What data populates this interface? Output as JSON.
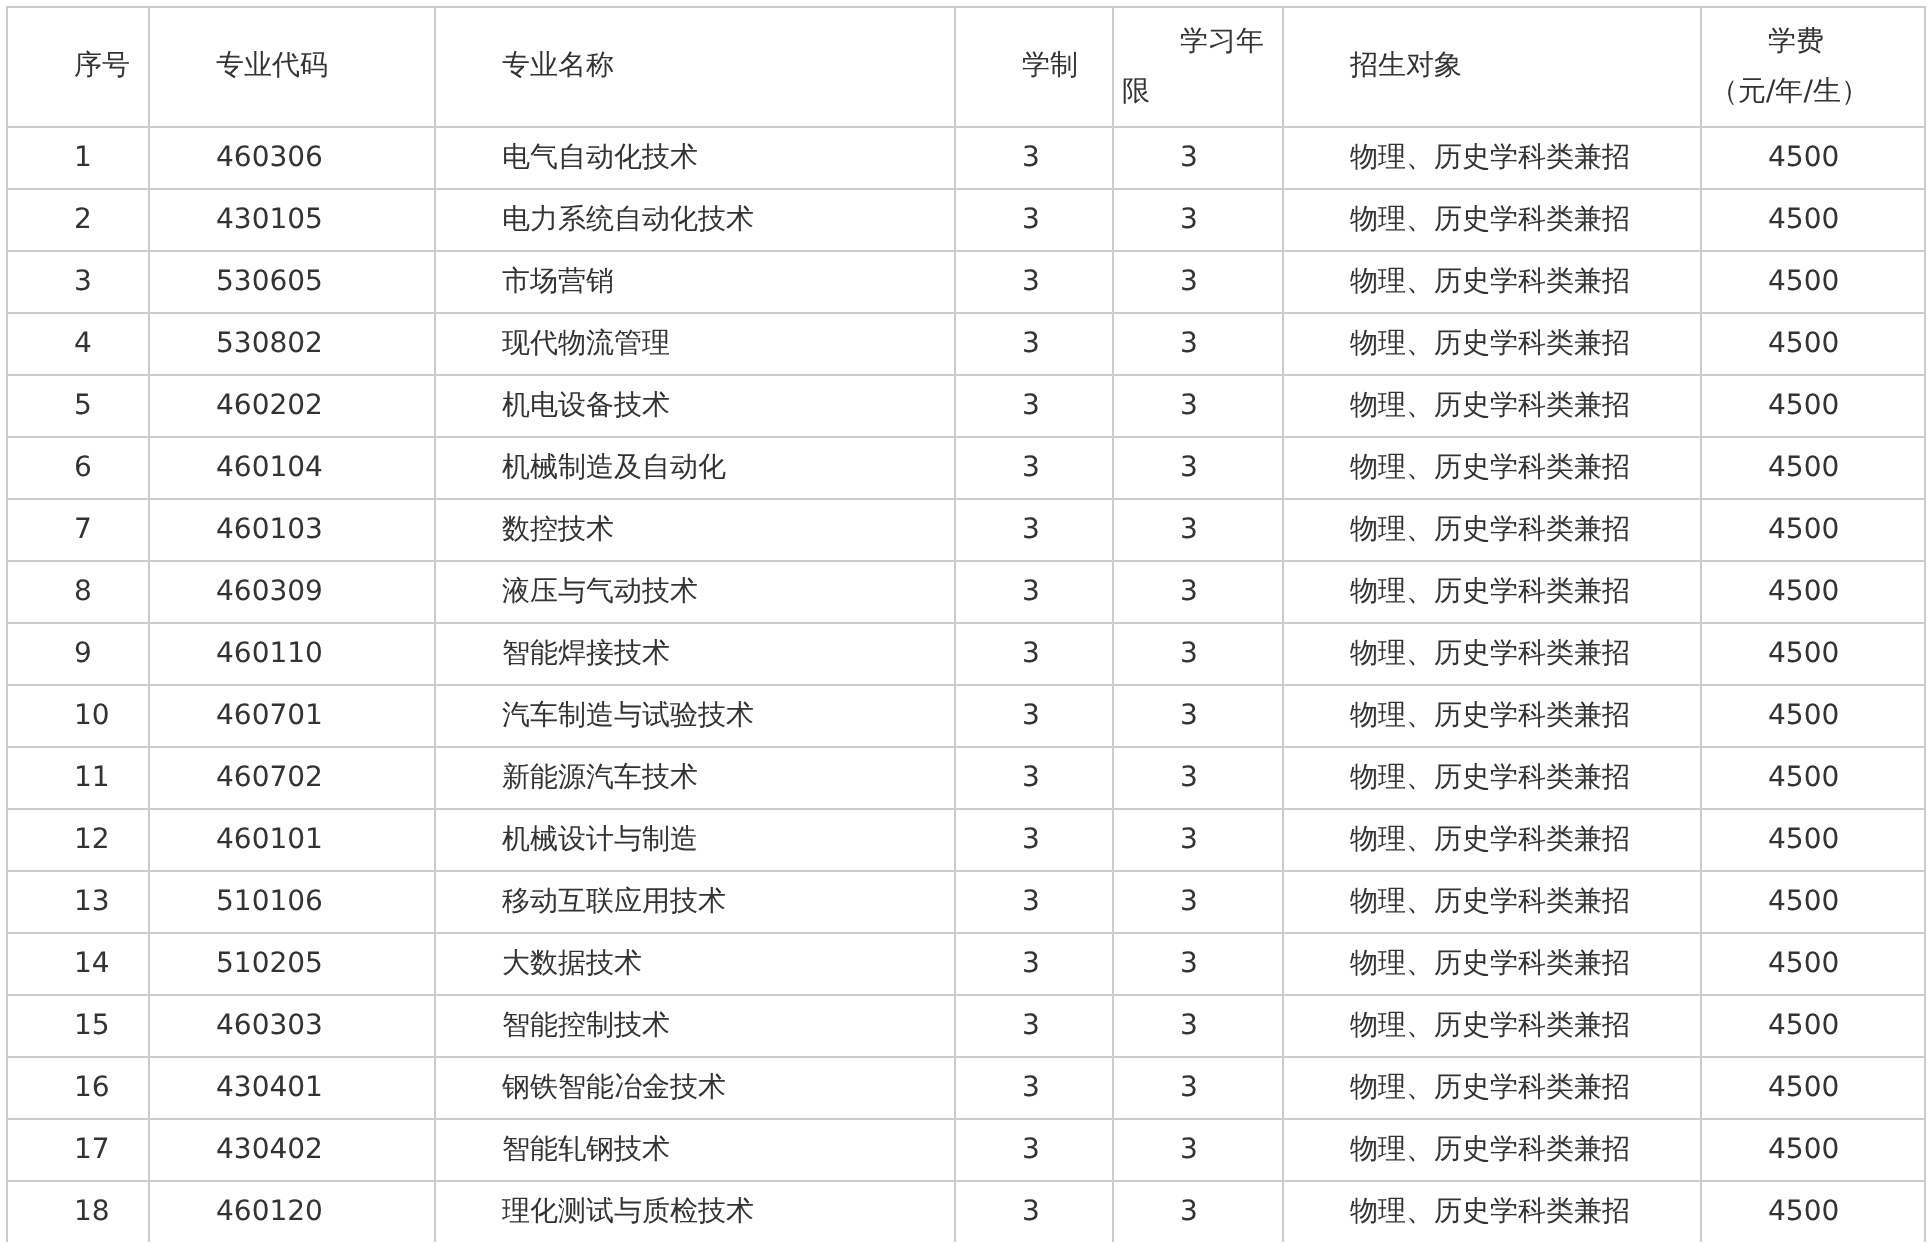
{
  "table": {
    "columns": [
      "序号",
      "专业代码",
      "专业名称",
      "学制",
      "学习年限",
      "招生对象",
      "学费（元/年/生）"
    ],
    "rows": [
      [
        "1",
        "460306",
        "电气自动化技术",
        "3",
        "3",
        "物理、历史学科类兼招",
        "4500"
      ],
      [
        "2",
        "430105",
        "电力系统自动化技术",
        "3",
        "3",
        "物理、历史学科类兼招",
        "4500"
      ],
      [
        "3",
        "530605",
        "市场营销",
        "3",
        "3",
        "物理、历史学科类兼招",
        "4500"
      ],
      [
        "4",
        "530802",
        "现代物流管理",
        "3",
        "3",
        "物理、历史学科类兼招",
        "4500"
      ],
      [
        "5",
        "460202",
        "机电设备技术",
        "3",
        "3",
        "物理、历史学科类兼招",
        "4500"
      ],
      [
        "6",
        "460104",
        "机械制造及自动化",
        "3",
        "3",
        "物理、历史学科类兼招",
        "4500"
      ],
      [
        "7",
        "460103",
        "数控技术",
        "3",
        "3",
        "物理、历史学科类兼招",
        "4500"
      ],
      [
        "8",
        "460309",
        "液压与气动技术",
        "3",
        "3",
        "物理、历史学科类兼招",
        "4500"
      ],
      [
        "9",
        "460110",
        "智能焊接技术",
        "3",
        "3",
        "物理、历史学科类兼招",
        "4500"
      ],
      [
        "10",
        "460701",
        "汽车制造与试验技术",
        "3",
        "3",
        "物理、历史学科类兼招",
        "4500"
      ],
      [
        "11",
        "460702",
        "新能源汽车技术",
        "3",
        "3",
        "物理、历史学科类兼招",
        "4500"
      ],
      [
        "12",
        "460101",
        "机械设计与制造",
        "3",
        "3",
        "物理、历史学科类兼招",
        "4500"
      ],
      [
        "13",
        "510106",
        "移动互联应用技术",
        "3",
        "3",
        "物理、历史学科类兼招",
        "4500"
      ],
      [
        "14",
        "510205",
        "大数据技术",
        "3",
        "3",
        "物理、历史学科类兼招",
        "4500"
      ],
      [
        "15",
        "460303",
        "智能控制技术",
        "3",
        "3",
        "物理、历史学科类兼招",
        "4500"
      ],
      [
        "16",
        "430401",
        "钢铁智能冶金技术",
        "3",
        "3",
        "物理、历史学科类兼招",
        "4500"
      ],
      [
        "17",
        "430402",
        "智能轧钢技术",
        "3",
        "3",
        "物理、历史学科类兼招",
        "4500"
      ],
      [
        "18",
        "460120",
        "理化测试与质检技术",
        "3",
        "3",
        "物理、历史学科类兼招",
        "4500"
      ]
    ]
  }
}
